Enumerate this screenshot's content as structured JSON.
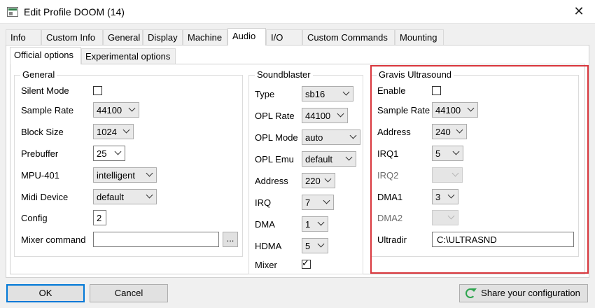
{
  "window": {
    "title": "Edit Profile DOOM (14)"
  },
  "tabs": [
    "Info",
    "Custom Info",
    "General",
    "Display",
    "Machine",
    "Audio",
    "I/O",
    "Custom Commands",
    "Mounting"
  ],
  "active_tab": "Audio",
  "subtabs": [
    "Official options",
    "Experimental options"
  ],
  "general": {
    "title": "General",
    "silent_mode_label": "Silent Mode",
    "sample_rate_label": "Sample Rate",
    "sample_rate": "44100",
    "block_size_label": "Block Size",
    "block_size": "1024",
    "prebuffer_label": "Prebuffer",
    "prebuffer": "25",
    "mpu401_label": "MPU-401",
    "mpu401": "intelligent",
    "midi_device_label": "Midi Device",
    "midi_device": "default",
    "config_label": "Config",
    "config": "2",
    "mixer_command_label": "Mixer command",
    "mixer_command": "",
    "browse_label": "..."
  },
  "soundblaster": {
    "title": "Soundblaster",
    "type_label": "Type",
    "type": "sb16",
    "opl_rate_label": "OPL Rate",
    "opl_rate": "44100",
    "opl_mode_label": "OPL Mode",
    "opl_mode": "auto",
    "opl_emu_label": "OPL Emu",
    "opl_emu": "default",
    "address_label": "Address",
    "address": "220",
    "irq_label": "IRQ",
    "irq": "7",
    "dma_label": "DMA",
    "dma": "1",
    "hdma_label": "HDMA",
    "hdma": "5",
    "mixer_label": "Mixer",
    "mixer_checked": true
  },
  "gus": {
    "title": "Gravis Ultrasound",
    "enable_label": "Enable",
    "enable_checked": false,
    "sample_rate_label": "Sample Rate",
    "sample_rate": "44100",
    "address_label": "Address",
    "address": "240",
    "irq1_label": "IRQ1",
    "irq1": "5",
    "irq2_label": "IRQ2",
    "irq2": "",
    "dma1_label": "DMA1",
    "dma1": "3",
    "dma2_label": "DMA2",
    "dma2": "",
    "ultradir_label": "Ultradir",
    "ultradir": "C:\\ULTRASND"
  },
  "footer": {
    "ok": "OK",
    "cancel": "Cancel",
    "share": "Share your configuration"
  }
}
